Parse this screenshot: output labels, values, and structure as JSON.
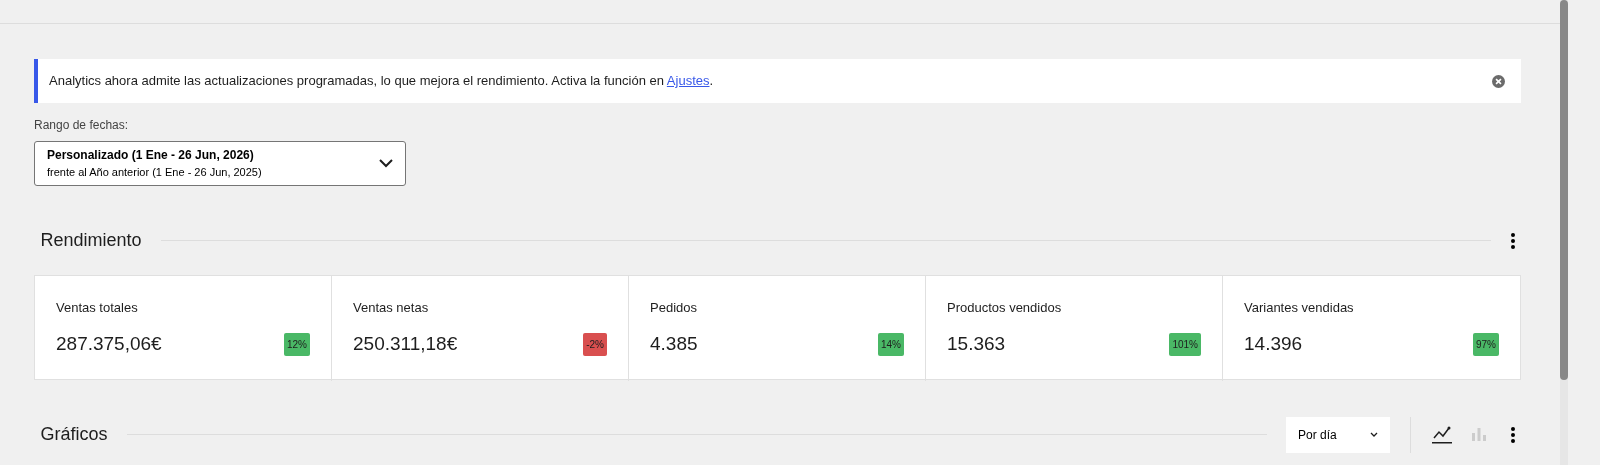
{
  "notice": {
    "text": "Analytics ahora admite las actualizaciones programadas, lo que mejora el rendimiento. Activa la función en ",
    "link": "Ajustes",
    "after": "."
  },
  "date_range": {
    "label": "Rango de fechas:",
    "primary": "Personalizado (1 Ene - 26 Jun, 2026)",
    "secondary": "frente al Año anterior (1 Ene - 26 Jun, 2025)"
  },
  "performance": {
    "title": "Rendimiento",
    "stats": [
      {
        "label": "Ventas totales",
        "value": "287.375,06€",
        "delta": "12%",
        "color": "#4ab866"
      },
      {
        "label": "Ventas netas",
        "value": "250.311,18€",
        "delta": "-2%",
        "color": "#d94f4f"
      },
      {
        "label": "Pedidos",
        "value": "4.385",
        "delta": "14%",
        "color": "#4ab866"
      },
      {
        "label": "Productos vendidos",
        "value": "15.363",
        "delta": "101%",
        "color": "#4ab866"
      },
      {
        "label": "Variantes vendidas",
        "value": "14.396",
        "delta": "97%",
        "color": "#4ab866"
      }
    ]
  },
  "charts": {
    "title": "Gráficos",
    "interval": "Por día",
    "chart_types": [
      {
        "kind": "line",
        "selected": true
      },
      {
        "kind": "bar",
        "selected": false
      }
    ]
  }
}
